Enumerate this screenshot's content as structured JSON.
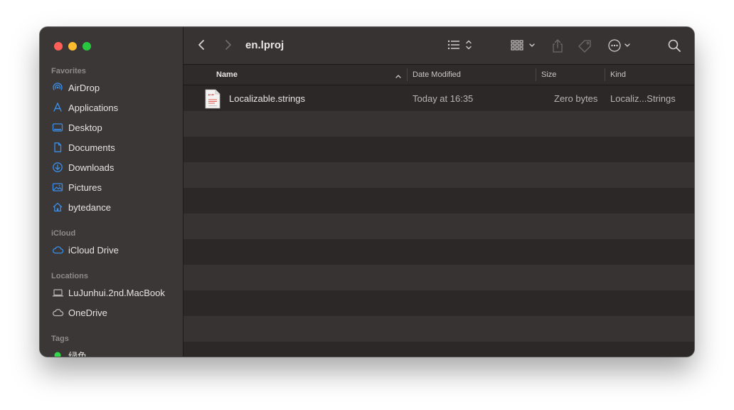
{
  "window": {
    "title": "en.lproj"
  },
  "sidebar": {
    "favorites_header": "Favorites",
    "favorites": [
      {
        "label": "AirDrop",
        "icon": "airdrop-icon"
      },
      {
        "label": "Applications",
        "icon": "applications-icon"
      },
      {
        "label": "Desktop",
        "icon": "desktop-icon"
      },
      {
        "label": "Documents",
        "icon": "document-icon"
      },
      {
        "label": "Downloads",
        "icon": "download-icon"
      },
      {
        "label": "Pictures",
        "icon": "pictures-icon"
      },
      {
        "label": "bytedance",
        "icon": "home-icon"
      }
    ],
    "icloud_header": "iCloud",
    "icloud": [
      {
        "label": "iCloud Drive",
        "icon": "cloud-icon"
      }
    ],
    "locations_header": "Locations",
    "locations": [
      {
        "label": "LuJunhui.2nd.MacBook",
        "icon": "laptop-icon"
      },
      {
        "label": "OneDrive",
        "icon": "cloud-icon"
      }
    ],
    "tags_header": "Tags",
    "tags": [
      {
        "label": "绿色",
        "color": "#32d74b"
      }
    ]
  },
  "columns": {
    "name": "Name",
    "date_modified": "Date Modified",
    "size": "Size",
    "kind": "Kind"
  },
  "files": [
    {
      "name": "Localizable.strings",
      "date_modified": "Today at 16:35",
      "size": "Zero bytes",
      "kind": "Localiz...Strings",
      "icon": "strings-file-icon"
    }
  ],
  "colors": {
    "accent": "#3b8ee8",
    "close": "#fe5f57",
    "minimize": "#febc2e",
    "maximize": "#28c840"
  }
}
